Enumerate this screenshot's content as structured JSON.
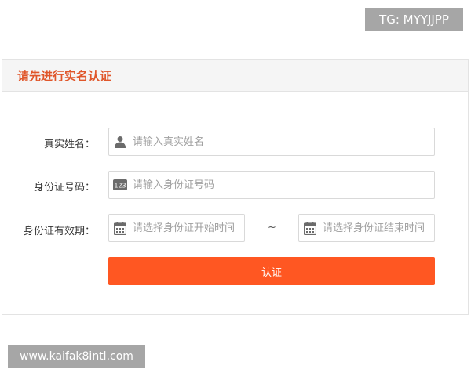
{
  "badge": {
    "text": "TG: MYYJJPP"
  },
  "panel": {
    "title": "请先进行实名认证",
    "accent_color": "#e0562a"
  },
  "form": {
    "name": {
      "label": "真实姓名：",
      "placeholder": "请输入真实姓名",
      "icon": "user-icon"
    },
    "id_number": {
      "label": "身份证号码：",
      "placeholder": "请输入身份证号码",
      "icon": "number-123-icon",
      "icon_text": "123"
    },
    "validity": {
      "label": "身份证有效期：",
      "start_placeholder": "请选择身份证开始时间",
      "end_placeholder": "请选择身份证结束时间",
      "separator": "~",
      "icon": "calendar-icon"
    },
    "submit": {
      "label": "认证",
      "color": "#ff5722"
    }
  },
  "watermark": {
    "text": "www.kaifak8intl.com"
  }
}
